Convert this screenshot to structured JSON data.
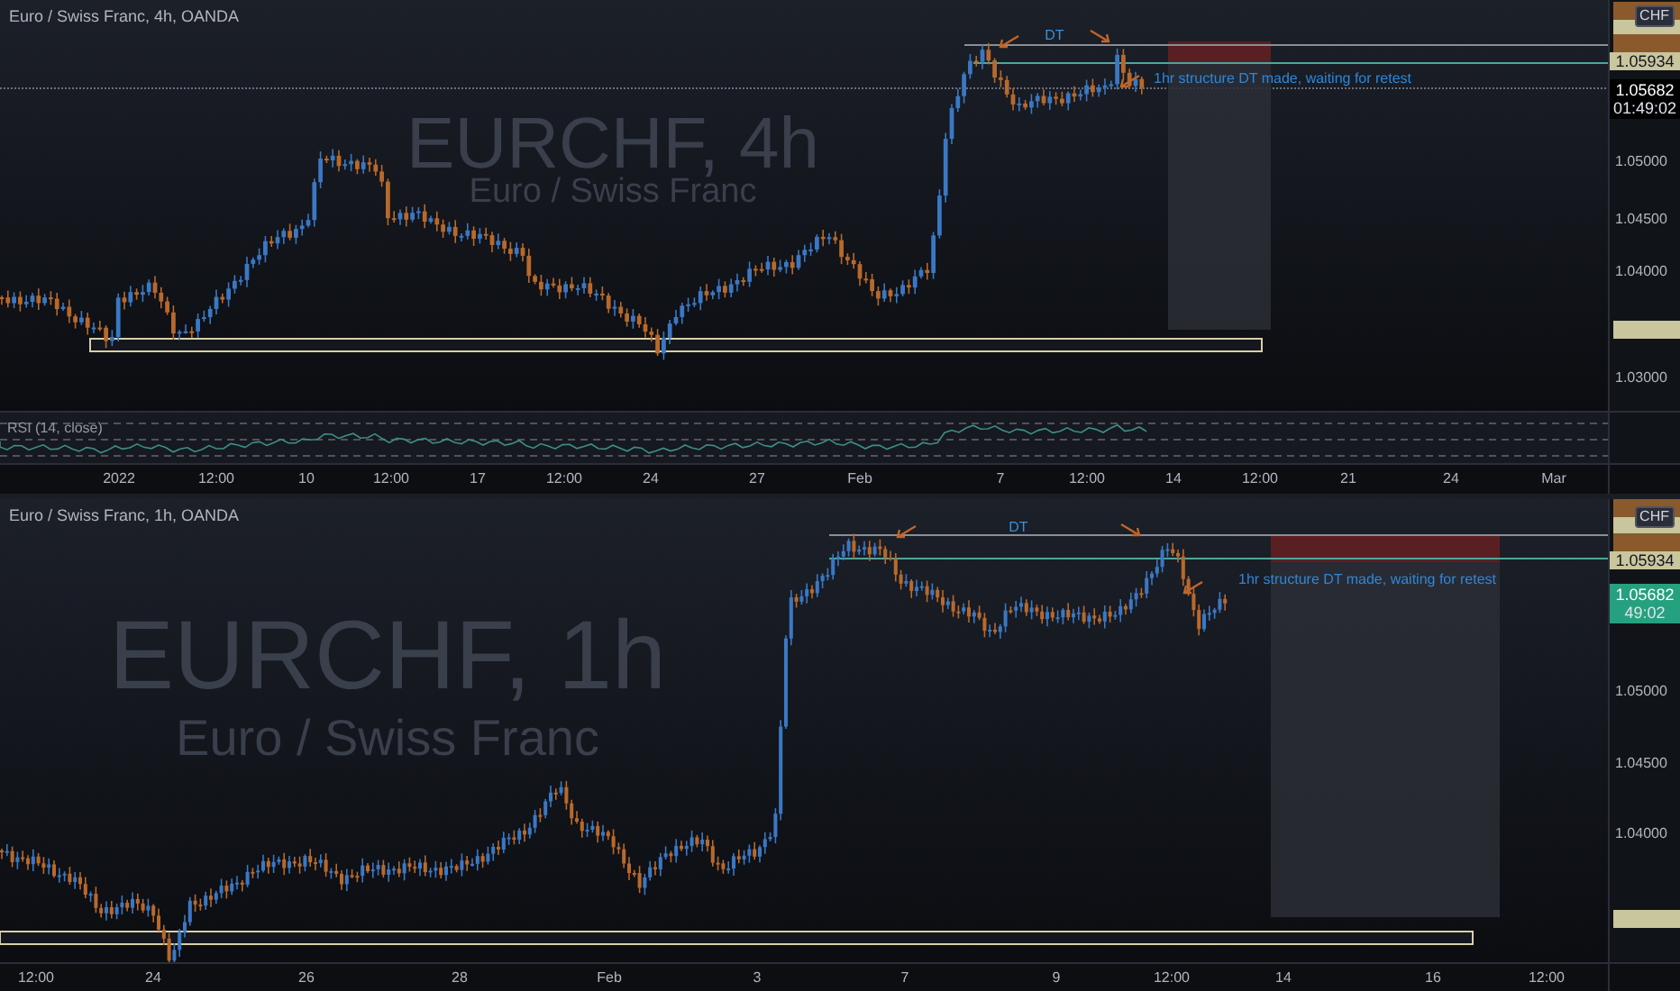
{
  "panes": [
    {
      "legend": "Euro / Swiss Franc, 4h, OANDA",
      "watermark": "EURCHF, 4h",
      "watermark_subtitle": "Euro / Swiss Franc",
      "pattern_label": "DT",
      "note": "1hr structure DT made, waiting for retest",
      "indicator": {
        "label": "RSI (14, close)"
      },
      "price_ticks": [
        "1.05000",
        "1.04500",
        "1.04000",
        "1.03000"
      ],
      "price_tags": [
        {
          "kind": "currency",
          "text": "CHF"
        },
        {
          "kind": "blank",
          "color": "#8a5a2c"
        },
        {
          "kind": "blank",
          "color": "#c9c59d"
        },
        {
          "kind": "blank",
          "color": "#8a5a2c"
        },
        {
          "kind": "level",
          "text": "1.05934",
          "color": "#c9c59d"
        },
        {
          "kind": "last",
          "text": "1.05682",
          "countdown": "01:49:02",
          "color": "#000000"
        },
        {
          "kind": "blank",
          "color": "#c9c59d"
        }
      ],
      "time_ticks": [
        "2022",
        "12:00",
        "10",
        "12:00",
        "17",
        "12:00",
        "24",
        "27",
        "Feb",
        "7",
        "12:00",
        "14",
        "12:00",
        "21",
        "24",
        "Mar"
      ]
    },
    {
      "legend": "Euro / Swiss Franc, 1h, OANDA",
      "watermark": "EURCHF, 1h",
      "watermark_subtitle": "Euro / Swiss Franc",
      "pattern_label": "DT",
      "note": "1hr structure DT made, waiting for retest",
      "price_ticks": [
        "1.05000",
        "1.04500",
        "1.04000"
      ],
      "price_tags": [
        {
          "kind": "currency",
          "text": "CHF"
        },
        {
          "kind": "blank",
          "color": "#8a5a2c"
        },
        {
          "kind": "blank",
          "color": "#c9c59d"
        },
        {
          "kind": "blank",
          "color": "#8a5a2c"
        },
        {
          "kind": "level",
          "text": "1.05934",
          "color": "#c9c59d"
        },
        {
          "kind": "last",
          "text": "1.05682",
          "countdown": "49:02",
          "color": "#26a17f"
        },
        {
          "kind": "blank",
          "color": "#c9c59d"
        }
      ],
      "time_ticks": [
        "12:00",
        "24",
        "26",
        "28",
        "Feb",
        "3",
        "7",
        "9",
        "12:00",
        "14",
        "16",
        "12:00"
      ]
    }
  ]
}
